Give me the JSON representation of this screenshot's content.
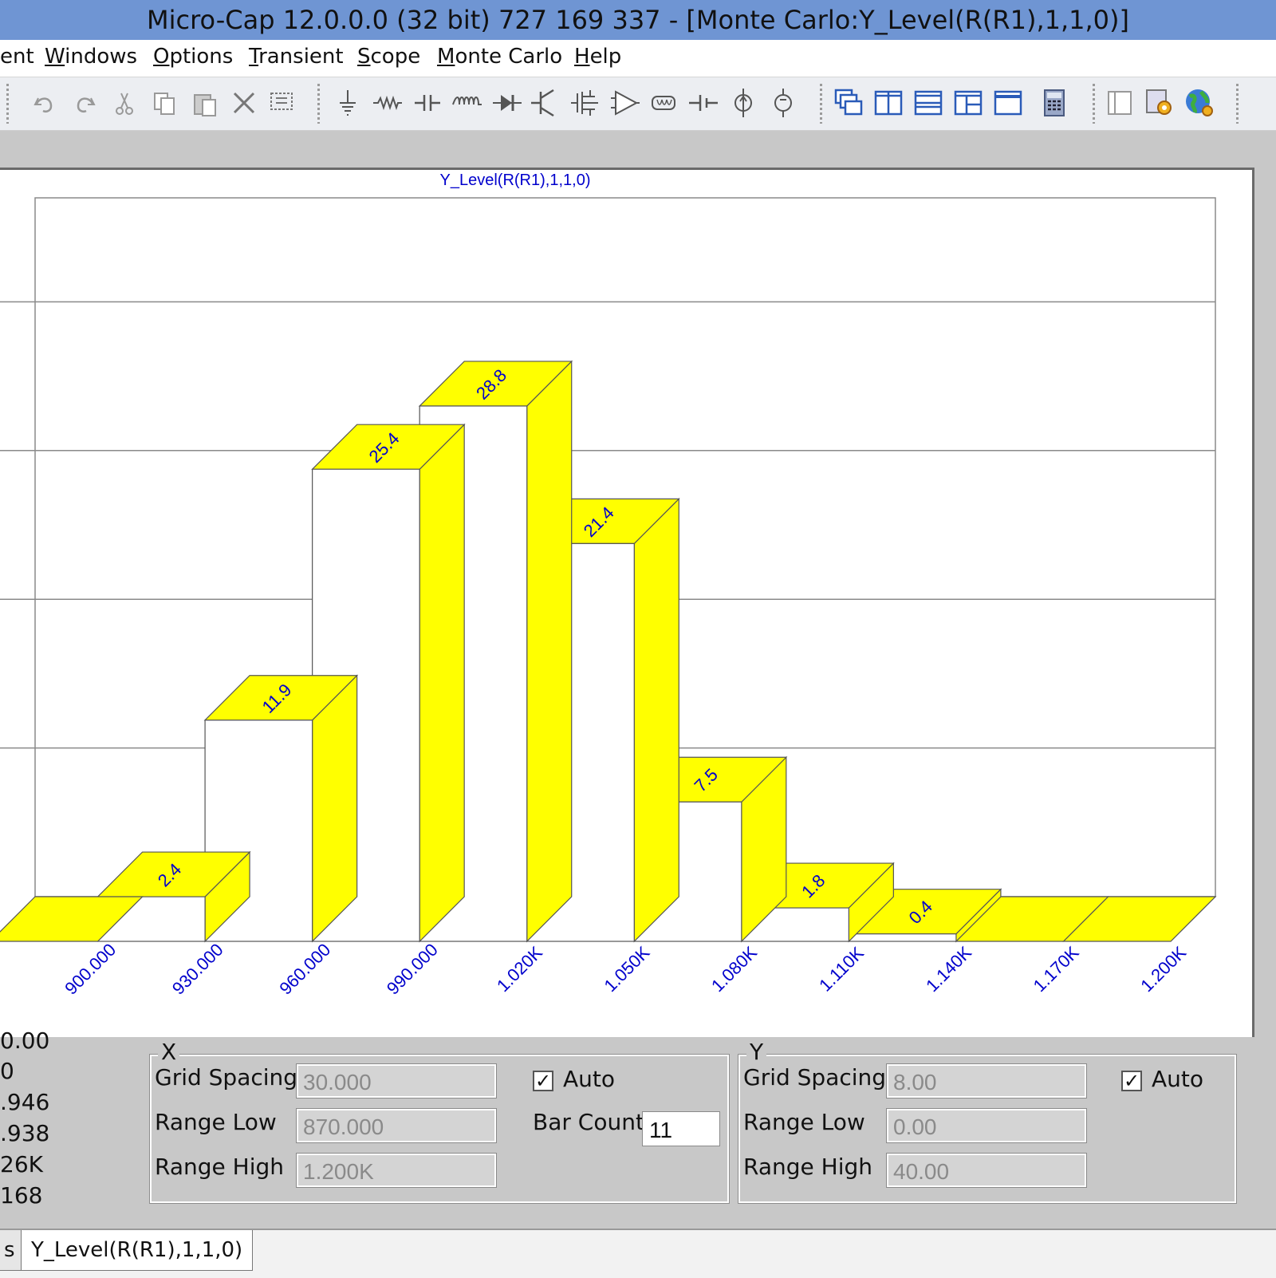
{
  "window": {
    "title": "Micro-Cap 12.0.0.0 (32 bit) 727 169 337 - [Monte Carlo:Y_Level(R(R1),1,1,0)]"
  },
  "menu": [
    {
      "pre": "",
      "u": "",
      "post": "ent"
    },
    {
      "pre": "",
      "u": "W",
      "post": "indows"
    },
    {
      "pre": "",
      "u": "O",
      "post": "ptions"
    },
    {
      "pre": "",
      "u": "T",
      "post": "ransient"
    },
    {
      "pre": "",
      "u": "S",
      "post": "cope"
    },
    {
      "pre": "",
      "u": "M",
      "post": "onte Carlo"
    },
    {
      "pre": "",
      "u": "H",
      "post": "elp"
    }
  ],
  "toolbar_icons": [
    "undo-icon",
    "redo-icon",
    "cut-icon",
    "copy-icon",
    "paste-icon",
    "delete-icon",
    "select-all-icon",
    "ground-icon",
    "resistor-icon",
    "capacitor-icon",
    "inductor-icon",
    "diode-icon",
    "bjt-icon",
    "mosfet-icon",
    "opamp-icon",
    "transmission-line-icon",
    "battery-icon",
    "current-source-icon",
    "voltage-source-icon",
    "cascade-icon",
    "tile-vertical-icon",
    "tile-horizontal-icon",
    "window-split-icon",
    "maximize-window-icon",
    "calculator-icon",
    "panel-icon",
    "settings-icon",
    "globe-icon"
  ],
  "chart_data": {
    "type": "bar",
    "title": "Y_Level(R(R1),1,1,0)",
    "categories": [
      "900.000",
      "930.000",
      "960.000",
      "990.000",
      "1.020K",
      "1.050K",
      "1.080K",
      "1.110K",
      "1.140K",
      "1.170K",
      "1.200K"
    ],
    "bar_edges": [
      870,
      900,
      930,
      960,
      990,
      1020,
      1050,
      1080,
      1110,
      1140,
      1170,
      1200
    ],
    "values": [
      0.0,
      2.4,
      11.9,
      25.4,
      28.8,
      21.4,
      7.5,
      1.8,
      0.4,
      0.0,
      0.0
    ],
    "value_labels": [
      "",
      "2.4",
      "11.9",
      "25.4",
      "28.8",
      "21.4",
      "7.5",
      "1.8",
      "0.4",
      "",
      ""
    ],
    "xlim": [
      870,
      1200
    ],
    "ylim": [
      0,
      40
    ],
    "y_grid_spacing": 8,
    "grid": true,
    "bar_face_color": "#ffffff",
    "bar_top_color": "#ffff00",
    "label_color": "#0000cc"
  },
  "stats": [
    "0.00",
    "0",
    ".946",
    ".938",
    "26K",
    "168"
  ],
  "x_group": {
    "legend": "X",
    "grid_spacing_label": "Grid Spacing",
    "grid_spacing": "30.000",
    "range_low_label": "Range Low",
    "range_low": "870.000",
    "range_high_label": "Range High",
    "range_high": "1.200K",
    "auto_label": "Auto",
    "auto_checked": "✓",
    "bar_count_label": "Bar Count",
    "bar_count": "11"
  },
  "y_group": {
    "legend": "Y",
    "grid_spacing_label": "Grid Spacing",
    "grid_spacing": "8.00",
    "range_low_label": "Range Low",
    "range_low": "0.00",
    "range_high_label": "Range High",
    "range_high": "40.00",
    "auto_label": "Auto",
    "auto_checked": "✓"
  },
  "tabs": [
    "s",
    "Y_Level(R(R1),1,1,0)"
  ]
}
